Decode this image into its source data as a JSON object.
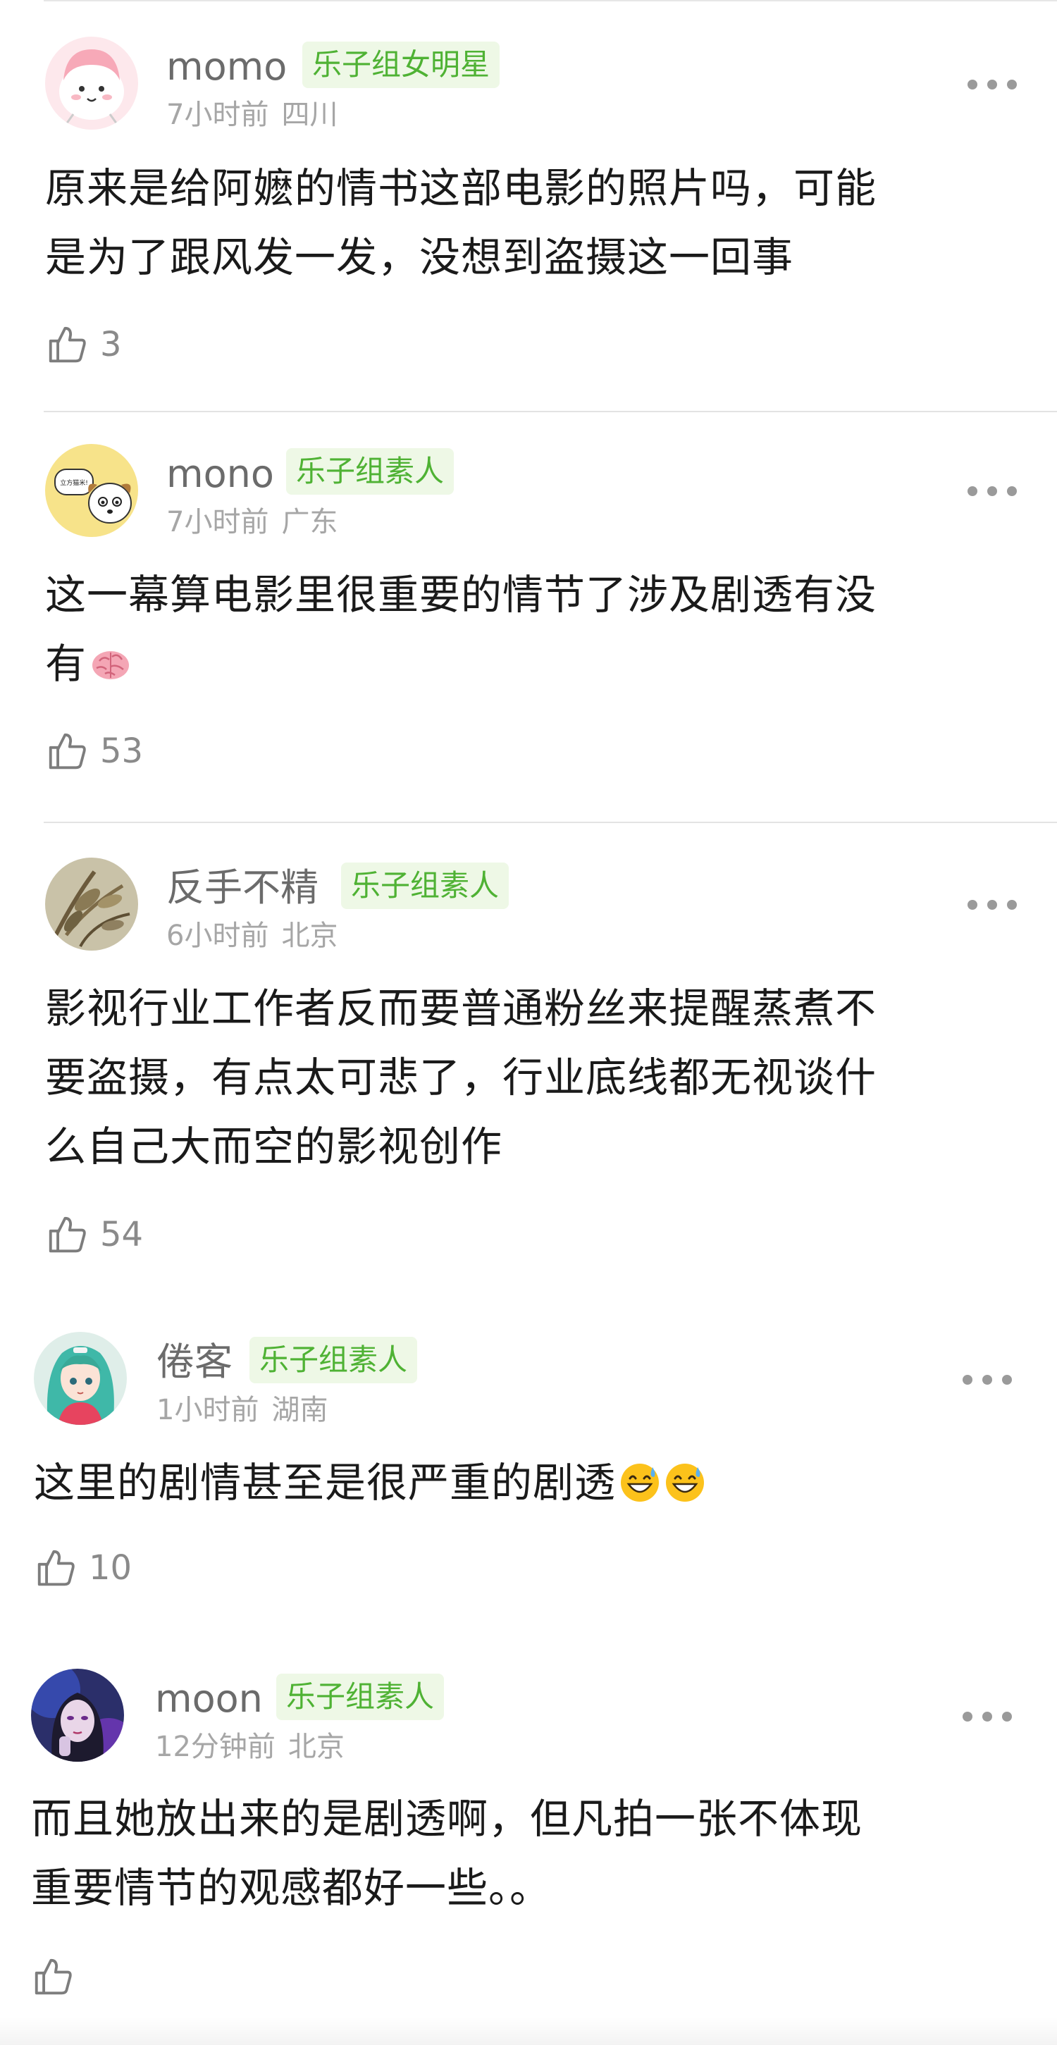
{
  "colors": {
    "badge_bg": "#eef8e6",
    "badge_text": "#4fb234",
    "username": "#6b6b6b",
    "meta": "#a6a6a6",
    "body_text": "#1a1a1a",
    "divider": "#e3e3e3"
  },
  "comments": [
    {
      "username": "momo",
      "badge": "乐子组女明星",
      "time": "7小时前",
      "location": "四川",
      "text_lines": [
        "原来是给阿嬷的情书这部电影的照片吗，可能",
        "是为了跟风发一发，没想到盗摄这一回事"
      ],
      "likes": "3",
      "avatar_icon": "pink-cartoon-avatar-icon"
    },
    {
      "username": "mono",
      "badge": "乐子组素人",
      "time": "7小时前",
      "location": "广东",
      "text_lines": [
        "这一幕算电影里很重要的情节了涉及剧透有没",
        "有"
      ],
      "emoji": "brain-emoji",
      "likes": "53",
      "avatar_icon": "cartoon-dog-avatar-icon"
    },
    {
      "username": "反手不精",
      "badge": "乐子组素人",
      "time": "6小时前",
      "location": "北京",
      "text_lines": [
        "影视行业工作者反而要普通粉丝来提醒蒸煮不",
        "要盗摄，有点太可悲了，行业底线都无视谈什",
        "么自己大而空的影视创作"
      ],
      "likes": "54",
      "avatar_icon": "plant-photo-avatar-icon"
    },
    {
      "username": "倦客",
      "badge": "乐子组素人",
      "time": "1小时前",
      "location": "湖南",
      "text_lines": [
        "这里的剧情甚至是很严重的剧透"
      ],
      "emoji": "grinning-sweat-emoji",
      "likes": "10",
      "avatar_icon": "anime-girl-avatar-icon"
    },
    {
      "username": "moon",
      "badge": "乐子组素人",
      "time": "12分钟前",
      "location": "北京",
      "text_lines": [
        "而且她放出来的是剧透啊，但凡拍一张不体现",
        "重要情节的观感都好一些。。"
      ],
      "likes": "",
      "avatar_icon": "neon-portrait-avatar-icon"
    }
  ]
}
